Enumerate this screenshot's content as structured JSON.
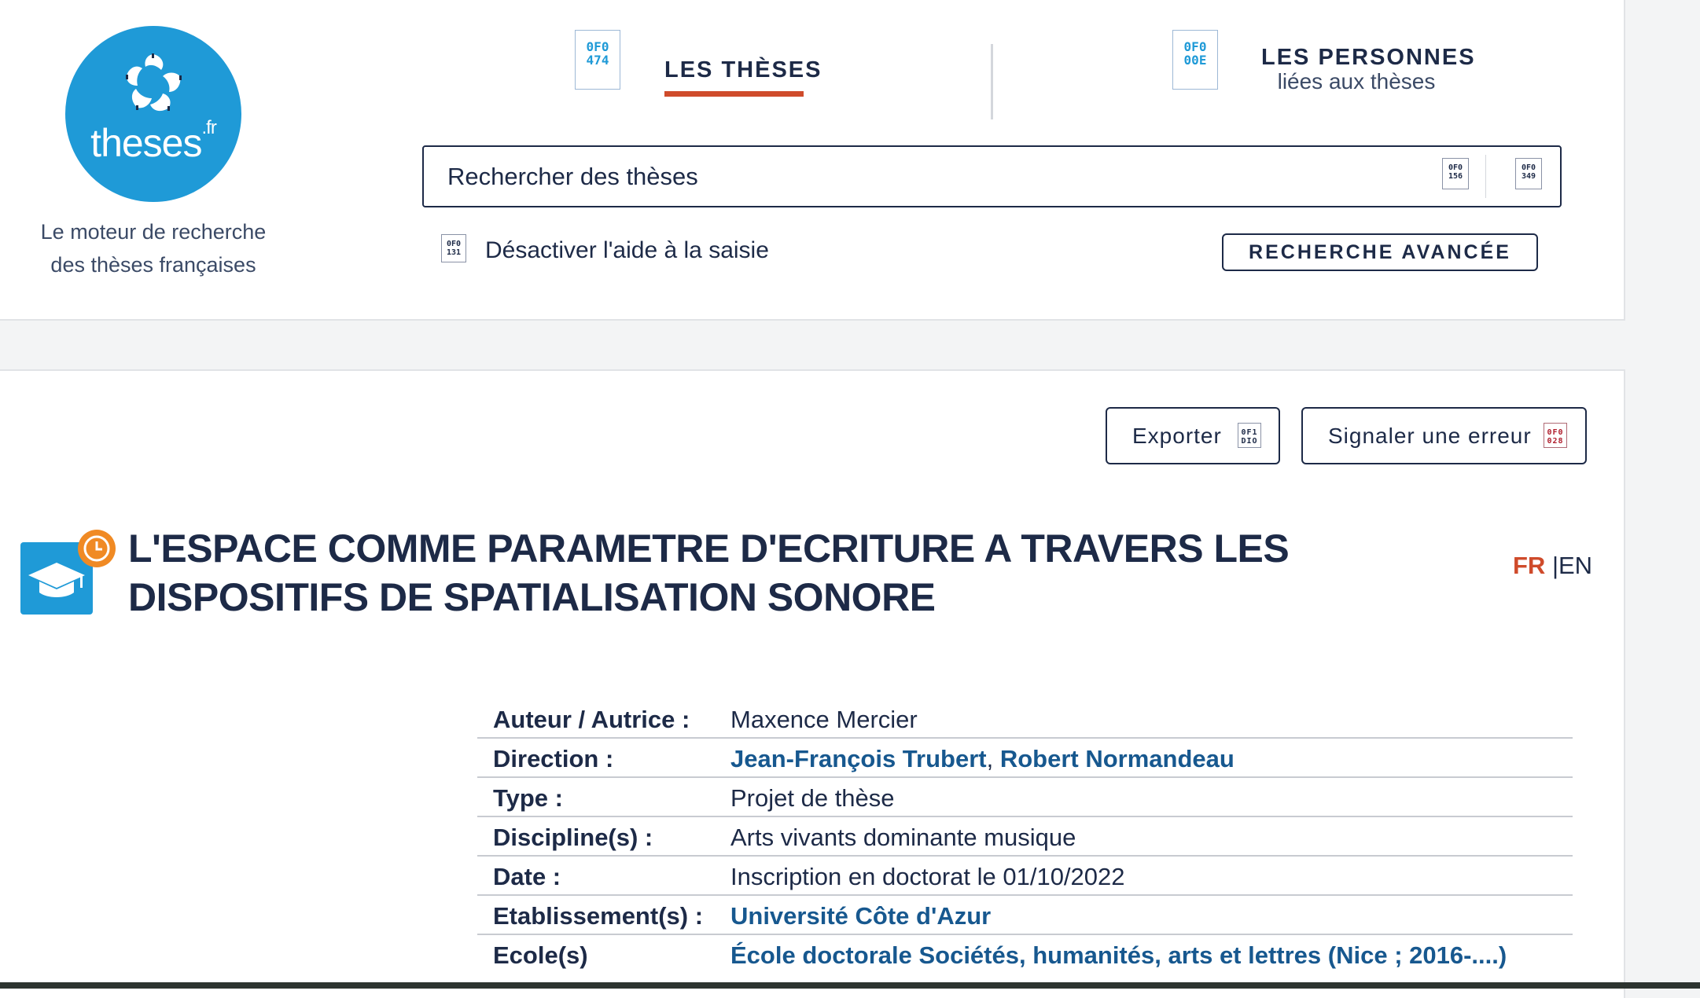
{
  "brand": {
    "logo_text": "theses",
    "logo_suffix": ".fr",
    "tagline_line1": "Le moteur de recherche",
    "tagline_line2": "des thèses françaises",
    "color": "#1f9ad7"
  },
  "tabs": [
    {
      "label": "LES THÈSES",
      "icon": "thesis-tab-icon",
      "glyph": "0F0 474",
      "active": true
    },
    {
      "label": "LES PERSONNES",
      "sublabel": "liées aux thèses",
      "icon": "people-tab-icon",
      "glyph": "0F0 00E",
      "active": false
    }
  ],
  "search": {
    "placeholder": "Rechercher des thèses",
    "clear_glyph": "0F0 156",
    "submit_glyph": "0F0 349"
  },
  "assist": {
    "toggle_label": "Désactiver l'aide à la saisie",
    "toggle_glyph": "0F0 131",
    "advanced_label": "RECHERCHE AVANCÉE"
  },
  "actions": {
    "export_label": "Exporter",
    "export_glyph": "0F1 DIO",
    "report_label": "Signaler une erreur",
    "report_glyph": "0F0 028"
  },
  "thesis": {
    "title_line1": "L'ESPACE COMME PARAMETRE D'ECRITURE A TRAVERS LES",
    "title_line2": "DISPOSITIFS DE SPATIALISATION SONORE",
    "status_icon": "clock-icon"
  },
  "lang": {
    "fr": "FR",
    "sep": " |",
    "en": "EN",
    "active": "FR"
  },
  "details": {
    "author_label": "Auteur / Autrice :",
    "author_value": "Maxence Mercier",
    "direction_label": "Direction :",
    "director1": "Jean-François Trubert",
    "director_sep": ", ",
    "director2": "Robert Normandeau",
    "type_label": "Type :",
    "type_value": "Projet de thèse",
    "discipline_label": "Discipline(s) :",
    "discipline_value": "Arts vivants dominante musique",
    "date_label": "Date :",
    "date_value": "Inscription en doctorat le 01/10/2022",
    "institution_label": "Etablissement(s) :",
    "institution_value": "Université Côte d'Azur",
    "school_label": "Ecole(s)",
    "school_value": "École doctorale Sociétés, humanités, arts et lettres (Nice ; 2016-....)"
  },
  "colors": {
    "navy": "#1d2a47",
    "accent_red": "#cf4b2b",
    "link_blue": "#17588f",
    "brand_blue": "#1f9ad7"
  }
}
